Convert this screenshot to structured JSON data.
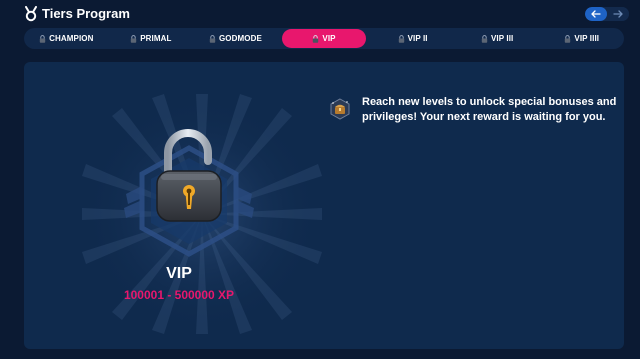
{
  "app": {
    "title": "Tiers Program",
    "logo_icon": "trophy-icon"
  },
  "nav": {
    "prev_icon": "arrow-left-icon",
    "next_icon": "arrow-right-icon"
  },
  "tabs": [
    {
      "label": "CHAMPION",
      "icon": "lock-icon",
      "active": false
    },
    {
      "label": "PRIMAL",
      "icon": "lock-icon",
      "active": false
    },
    {
      "label": "GODMODE",
      "icon": "lock-icon",
      "active": false
    },
    {
      "label": "VIP",
      "icon": "lock-icon",
      "active": true
    },
    {
      "label": "VIP II",
      "icon": "lock-icon",
      "active": false
    },
    {
      "label": "VIP III",
      "icon": "lock-icon",
      "active": false
    },
    {
      "label": "VIP IIII",
      "icon": "lock-icon",
      "active": false
    }
  ],
  "tier": {
    "name": "VIP",
    "xp_range": "100001 - 500000 XP",
    "status_icon": "open-padlock-icon"
  },
  "reward": {
    "icon": "treasure-chest-icon",
    "text": "Reach new levels to unlock special bonuses and privileges! Your next reward is waiting for you."
  },
  "colors": {
    "background": "#0b1a33",
    "card": "#0f2a4d",
    "accent": "#e8176d",
    "nav_active": "#1e63c6"
  }
}
